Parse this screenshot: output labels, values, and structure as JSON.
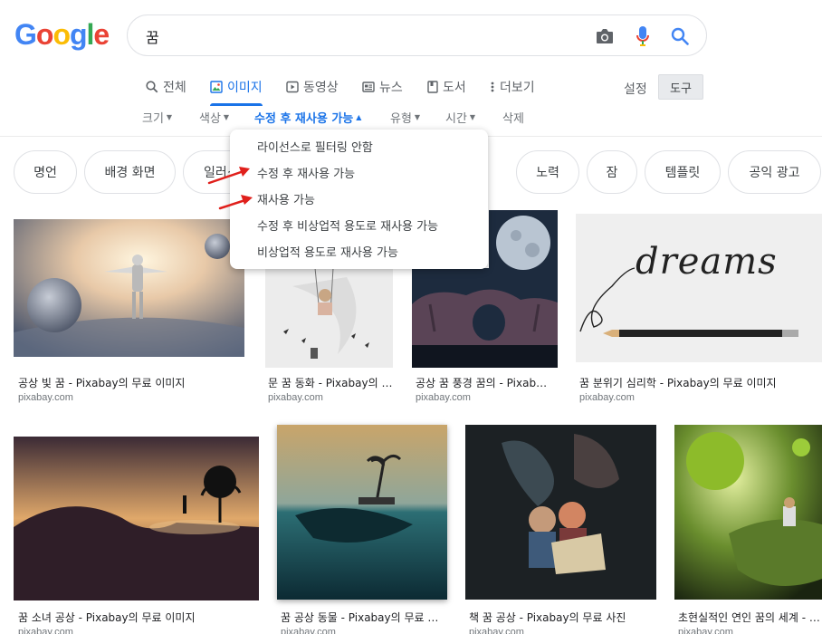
{
  "logo": {
    "letters": [
      "G",
      "o",
      "o",
      "g",
      "l",
      "e"
    ],
    "colors": [
      "#4285F4",
      "#EA4335",
      "#FBBC05",
      "#4285F4",
      "#34A853",
      "#EA4335"
    ]
  },
  "search": {
    "query": "꿈",
    "camera_icon": "camera-icon",
    "mic_icon": "microphone-icon",
    "search_icon": "search-icon"
  },
  "tabs": [
    {
      "label": "전체",
      "icon": "search-icon"
    },
    {
      "label": "이미지",
      "icon": "image-icon",
      "active": true
    },
    {
      "label": "동영상",
      "icon": "play-icon"
    },
    {
      "label": "뉴스",
      "icon": "news-icon"
    },
    {
      "label": "도서",
      "icon": "book-icon"
    },
    {
      "label": "더보기",
      "icon": "more-vert-icon"
    }
  ],
  "settings_label": "설정",
  "tools_label": "도구",
  "filters": [
    {
      "label": "크기"
    },
    {
      "label": "색상"
    },
    {
      "label": "수정 후 재사용 가능",
      "active": true
    },
    {
      "label": "유형"
    },
    {
      "label": "시간"
    },
    {
      "label": "삭제"
    }
  ],
  "chips": [
    "명언",
    "배경 화면",
    "일러스트",
    "노력",
    "잠",
    "템플릿",
    "공익 광고"
  ],
  "usage_rights_menu": [
    "라이선스로 필터링 안함",
    "수정 후 재사용 가능",
    "재사용 가능",
    "수정 후 비상업적 용도로 재사용 가능",
    "비상업적 용도로 재사용 가능"
  ],
  "results": [
    {
      "title": "공상 빛 꿈 - Pixabay의 무료 이미지",
      "source": "pixabay.com"
    },
    {
      "title": "문 꿈 동화 - Pixabay의 무료 이미지",
      "source": "pixabay.com"
    },
    {
      "title": "공상 꿈 풍경 꿈의 - Pixabay의 무료 이미지",
      "source": "pixabay.com"
    },
    {
      "title": "꿈 분위기 심리학 - Pixabay의 무료 이미지",
      "source": "pixabay.com"
    },
    {
      "title": "꿈 소녀 공상 - Pixabay의 무료 이미지",
      "source": "pixabay.com"
    },
    {
      "title": "꿈 공상 동물 - Pixabay의 무료 이미지",
      "source": "pixabay.com"
    },
    {
      "title": "책 꿈 공상 - Pixabay의 무료 사진",
      "source": "pixabay.com"
    },
    {
      "title": "초현실적인 연인 꿈의 세계 - Pixabay의 무료 이미지",
      "source": "pixabay.com"
    }
  ],
  "thumb_text": {
    "dreams": "dreams"
  }
}
